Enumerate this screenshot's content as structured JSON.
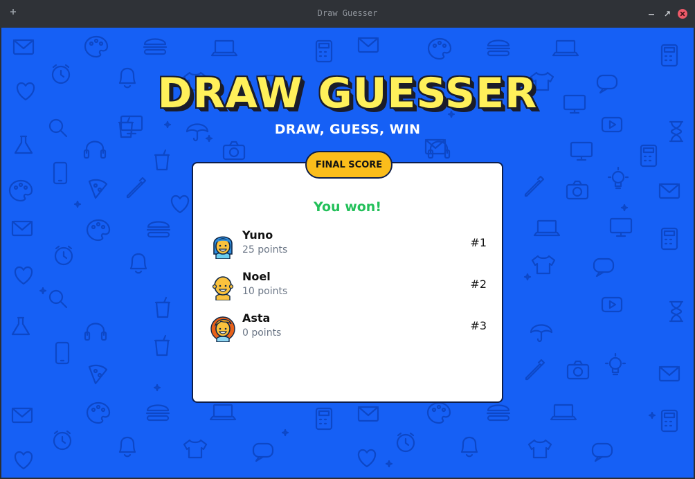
{
  "window": {
    "title": "Draw Guesser",
    "icons": [
      "plus-icon",
      "minimize-icon",
      "maximize-icon",
      "close-icon"
    ]
  },
  "app": {
    "logo": "DRAW GUESSER",
    "tagline": "DRAW, GUESS, WIN",
    "background_color": "#1660f5",
    "logo_color": "#fff05a"
  },
  "scoreboard": {
    "badge": "FINAL SCORE",
    "result": "You won!",
    "result_color": "#23c05a",
    "badge_color": "#fbbd1b",
    "players": [
      {
        "name": "Yuno",
        "points": "25 points",
        "rank": "#1",
        "avatar": "blue-hair-avatar"
      },
      {
        "name": "Noel",
        "points": "10 points",
        "rank": "#2",
        "avatar": "bald-avatar"
      },
      {
        "name": "Asta",
        "points": "0 points",
        "rank": "#3",
        "avatar": "orange-hair-avatar"
      }
    ]
  }
}
